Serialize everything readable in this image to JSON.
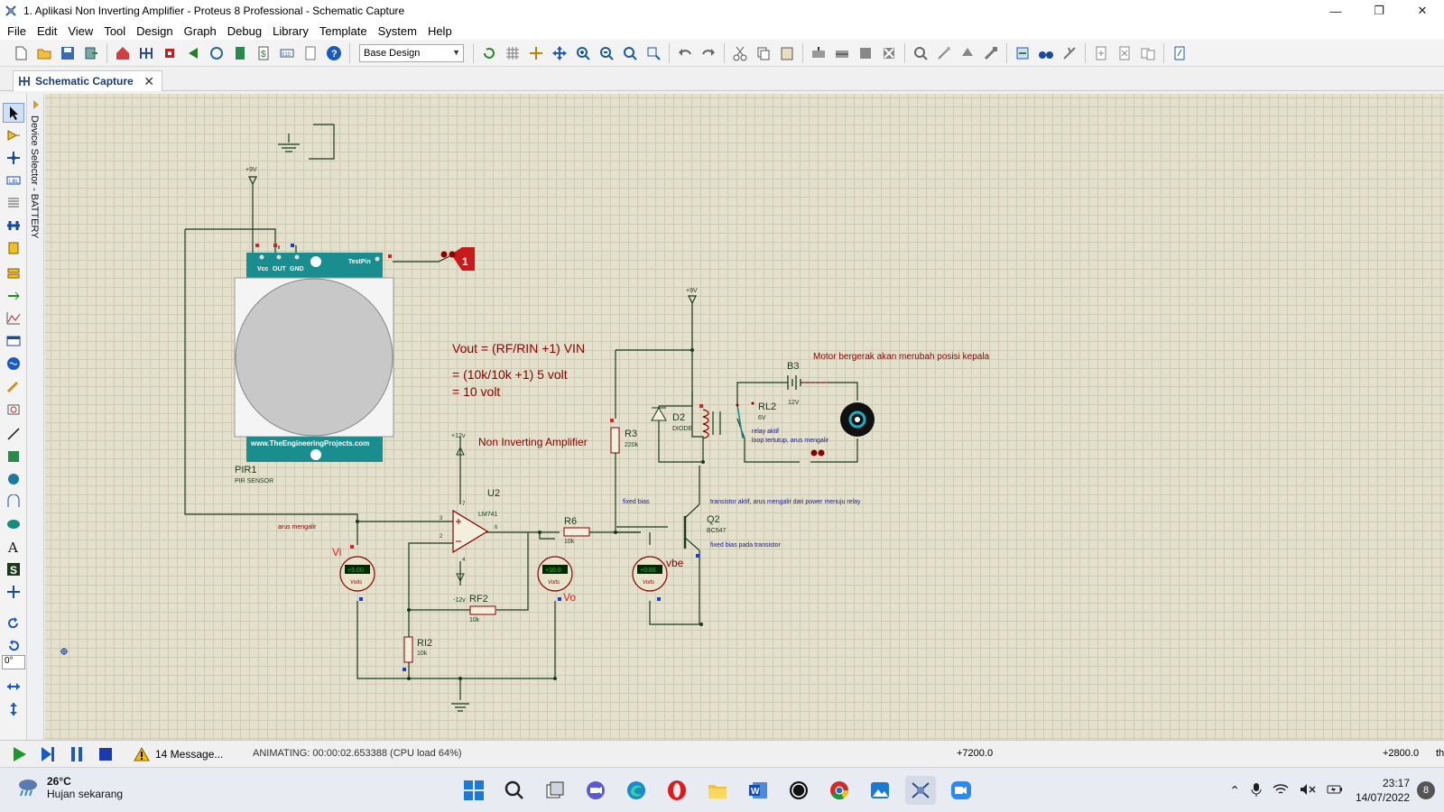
{
  "window": {
    "title": "1. Aplikasi Non Inverting Amplifier - Proteus 8 Professional - Schematic Capture",
    "minimize": "—",
    "restore": "❐",
    "close": "✕"
  },
  "menu": [
    "File",
    "Edit",
    "View",
    "Tool",
    "Design",
    "Graph",
    "Debug",
    "Library",
    "Template",
    "System",
    "Help"
  ],
  "toolbar": {
    "design_select": "Base Design"
  },
  "tab": {
    "label": "Schematic Capture",
    "close": "✕"
  },
  "device_selector": {
    "label": "Device Selector - BATTERY"
  },
  "rotation_input": "0°",
  "schematic": {
    "pir": {
      "site": "www.TheEngineeringProjects.com",
      "pin_vcc": "Vcc",
      "pin_out": "OUT",
      "pin_gnd": "GND",
      "pin_test": "TestPin",
      "ref": "PIR1",
      "type": "PIR SENSOR"
    },
    "probe_label": "1",
    "vcc_top": "+9V",
    "vcc_relay": "+9V",
    "opamp": {
      "ref": "U2",
      "type": "LM741",
      "pos_supply": "+12v",
      "neg_supply": "-12v",
      "pin3": "3",
      "pin2": "2",
      "pin6": "6",
      "pin7": "7",
      "pin4": "4"
    },
    "formula": {
      "line1": "Vout = (RF/RIN +1) VIN",
      "line2": "= (10k/10k +1) 5 volt",
      "line3": "= 10 volt"
    },
    "title_amp": "Non Inverting Amplifier",
    "r3": {
      "ref": "R3",
      "value": "220k"
    },
    "r6": {
      "ref": "R6",
      "value": "10k"
    },
    "rf2": {
      "ref": "RF2",
      "value": "10k"
    },
    "ri2": {
      "ref": "RI2",
      "value": "10k"
    },
    "d2": {
      "ref": "D2",
      "type": "DIODE"
    },
    "rl2": {
      "ref": "RL2",
      "value": "6V"
    },
    "relay_note1": "relay aktif",
    "relay_note2": "loop tertutup, arus mengalir",
    "b3": {
      "ref": "B3",
      "value": "12V"
    },
    "motor_note": "Motor bergerak akan merubah posisi kepala",
    "q2": {
      "ref": "Q2",
      "type": "BC547"
    },
    "fixed_bias": "fixed bias",
    "trans_note": "transistor aktif, arus mengalir dari power menuju relay",
    "trans_note2": "fixed bias pada transistor",
    "arus_note": "arus mengalir",
    "meter_vi": {
      "label": "Vi",
      "reading": "+5.00",
      "unit": "Volts"
    },
    "meter_vo": {
      "label": "Vo",
      "reading": "+10.0",
      "unit": "Volts"
    },
    "meter_vbe": {
      "label": "vbe",
      "reading": "+0.86",
      "unit": "Volts"
    }
  },
  "status": {
    "messages": "14 Message...",
    "animating": "ANIMATING: 00:00:02.653388 (CPU load 64%)",
    "coord_x": "+7200.0",
    "coord_y": "+2800.0",
    "coord_unit": "th"
  },
  "taskbar": {
    "temp": "26°C",
    "condition": "Hujan sekarang",
    "time": "23:17",
    "date": "14/07/2022",
    "notification_count": "8"
  },
  "colors": {
    "canvas": "#e3e1cd",
    "wire": "#1a3a1a",
    "teal": "#1a8e8e",
    "label_red": "#8b0000",
    "note_blue": "#1a1a8b",
    "meter_green": "#00aa00"
  }
}
